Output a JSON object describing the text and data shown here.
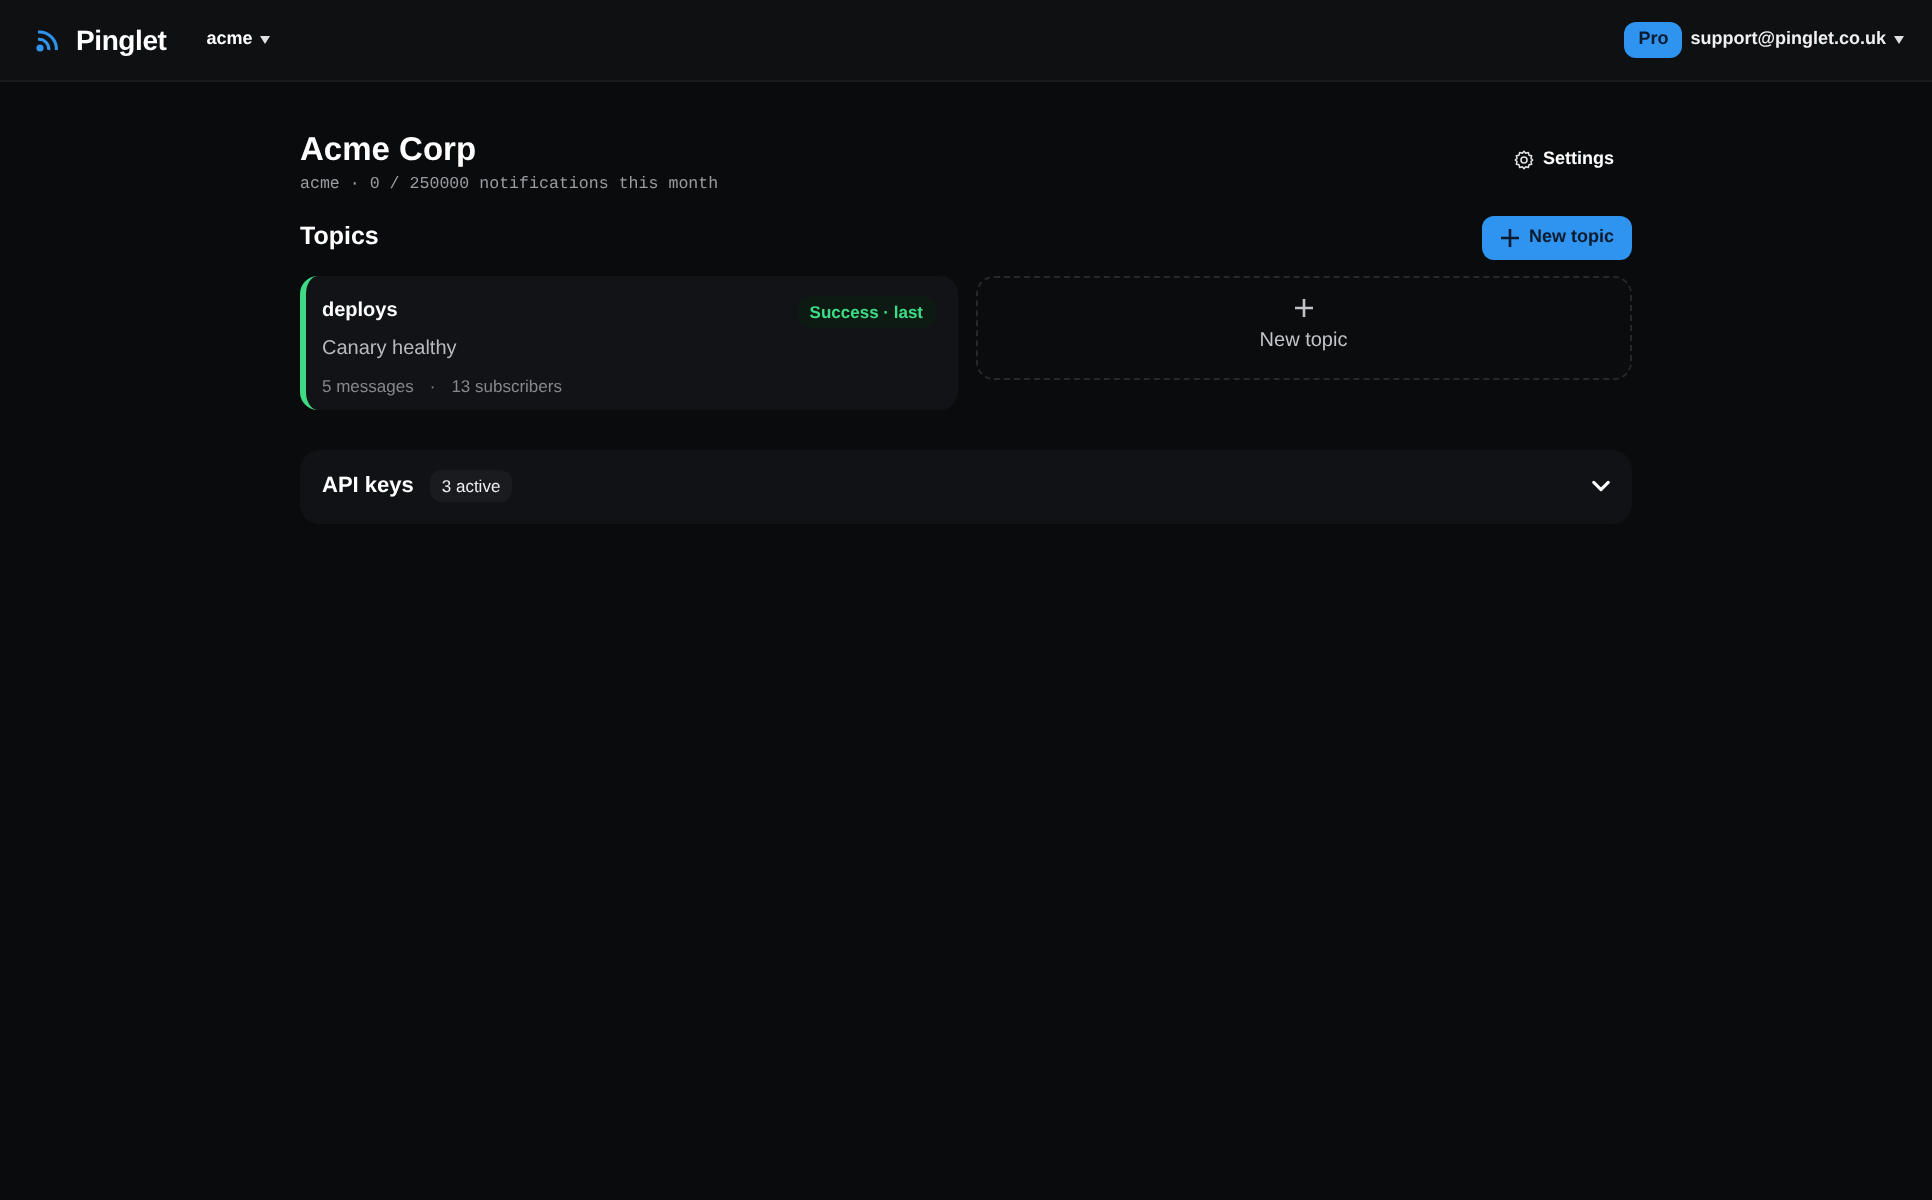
{
  "navbar": {
    "brand": "Pinglet",
    "workspace": "acme",
    "plan": "Pro",
    "account": "support@pinglet.co.uk"
  },
  "header": {
    "title": "Acme Corp",
    "subtitle": "acme · 0 / 250000 notifications this month",
    "settings": "Settings"
  },
  "topics": {
    "heading": "Topics",
    "new_button": "New topic",
    "items": [
      {
        "name": "deploys",
        "status": "Success · last",
        "color": "#3ddc84",
        "message": "Canary healthy",
        "messages": "5 messages",
        "separator": "·",
        "subscribers": "13 subscribers"
      }
    ],
    "add_card": {
      "label": "New topic"
    }
  },
  "api_keys": {
    "title": "API keys",
    "count": "3 active",
    "expanded": false
  }
}
